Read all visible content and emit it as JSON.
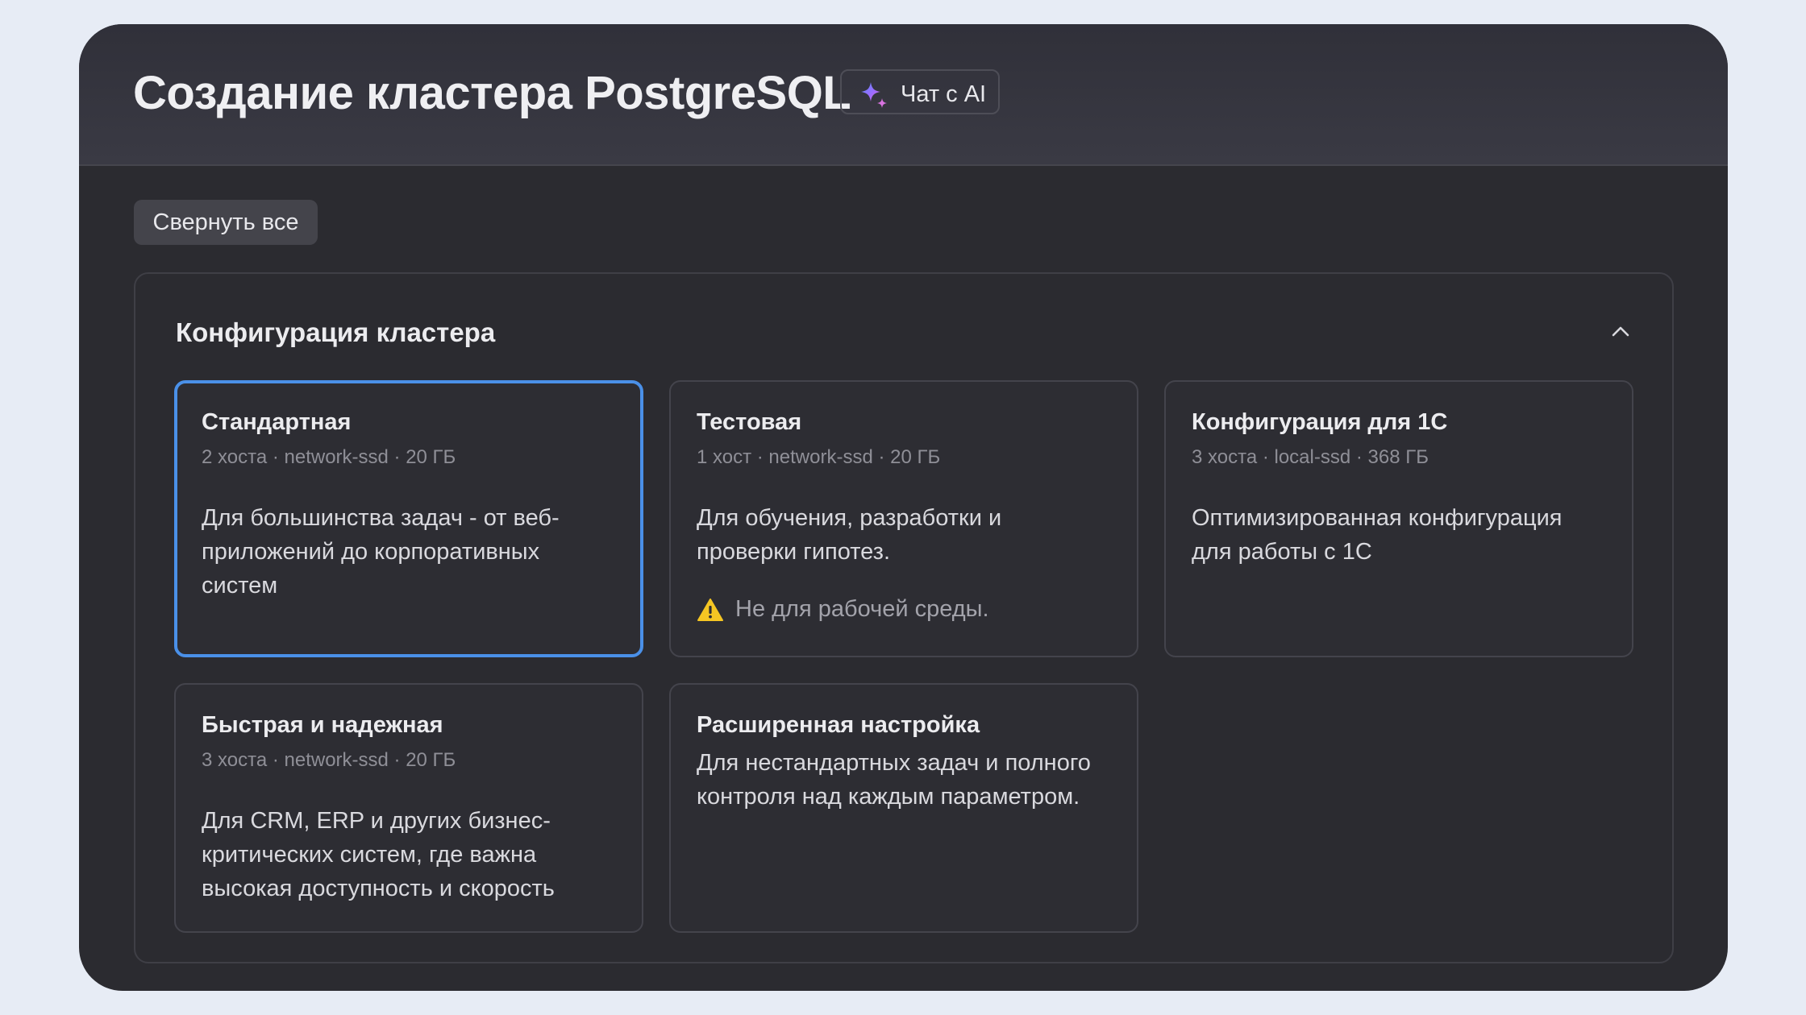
{
  "header": {
    "title": "Создание кластера PostgreSQL",
    "ai_chat_label": "Чат с AI"
  },
  "toolbar": {
    "collapse_all_label": "Свернуть все"
  },
  "section": {
    "title": "Конфигурация кластера",
    "cards": [
      {
        "title": "Стандартная",
        "meta": "2 хоста · network-ssd · 20 ГБ",
        "description": "Для большинства задач - от веб-приложений до корпоративных систем",
        "selected": true
      },
      {
        "title": "Тестовая",
        "meta": "1 хост · network-ssd · 20 ГБ",
        "description": "Для обучения, разработки и проверки гипотез.",
        "warning": "Не для рабочей среды."
      },
      {
        "title": "Конфигурация для 1С",
        "meta": "3 хоста · local-ssd · 368 ГБ",
        "description": "Оптимизированная конфигурация для работы с 1С"
      },
      {
        "title": "Быстрая и надежная",
        "meta": "3 хоста · network-ssd · 20 ГБ",
        "description": "Для CRM, ERP и других бизнес-критических систем, где важна высокая доступность и скорость"
      },
      {
        "title": "Расширенная настройка",
        "description": "Для нестандартных задач и полного контроля над каждым параметром."
      }
    ]
  },
  "colors": {
    "page_background": "#e7ecf5",
    "window_background": "#2b2b30",
    "selected_border": "#4a90e8",
    "warning_yellow": "#f5c623"
  },
  "icons": {
    "ai_chat": "sparkle-icon",
    "section_toggle": "chevron-up-icon",
    "warning": "warning-icon"
  }
}
